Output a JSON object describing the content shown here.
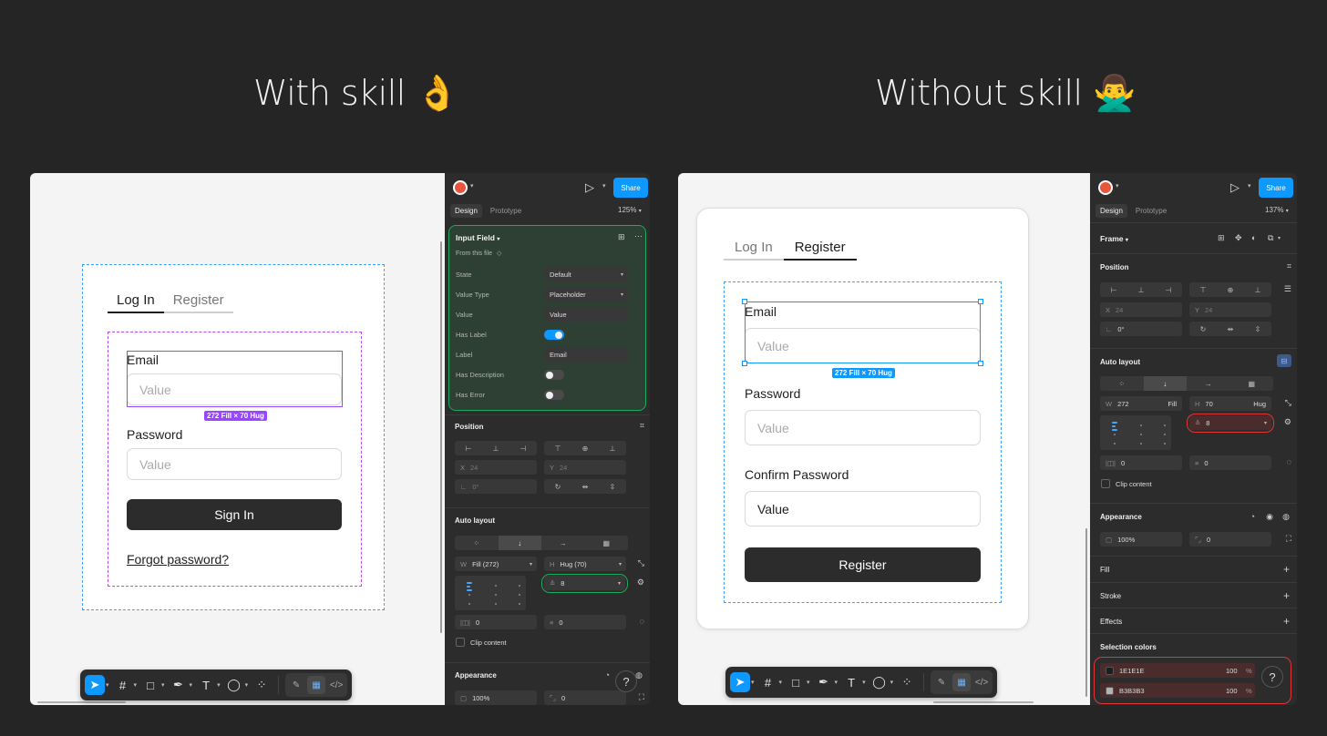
{
  "headings": {
    "left": "With skill 👌",
    "right": "Without skill 🙅‍♂️"
  },
  "left": {
    "canvas": {
      "tabs": [
        "Log In",
        "Register"
      ],
      "email_label": "Email",
      "email_placeholder": "Value",
      "size_tag": "272 Fill × 70 Hug",
      "password_label": "Password",
      "password_placeholder": "Value",
      "sign_in": "Sign In",
      "forgot": "Forgot password?"
    },
    "panel": {
      "share": "Share",
      "tabs": [
        "Design",
        "Prototype"
      ],
      "zoom": "125%",
      "component": {
        "name": "Input Field",
        "source": "From this file",
        "rows": [
          {
            "label": "State",
            "value": "Default",
            "kind": "select"
          },
          {
            "label": "Value Type",
            "value": "Placeholder",
            "kind": "select"
          },
          {
            "label": "Value",
            "value": "Value",
            "kind": "text"
          },
          {
            "label": "Has Label",
            "value": "on",
            "kind": "toggle"
          },
          {
            "label": "Label",
            "value": "Email",
            "kind": "text"
          },
          {
            "label": "Has Description",
            "value": "off",
            "kind": "toggle"
          },
          {
            "label": "Has Error",
            "value": "off",
            "kind": "toggle"
          }
        ]
      },
      "position": {
        "title": "Position",
        "x_label": "X",
        "x_value": "24",
        "y_label": "Y",
        "y_value": "24",
        "rotation": "0°"
      },
      "auto_layout": {
        "title": "Auto layout",
        "w_label": "W",
        "w_value": "Fill (272)",
        "h_label": "H",
        "h_value": "Hug (70)",
        "gap": "8",
        "pad_h": "0",
        "pad_v": "0",
        "clip": "Clip content"
      },
      "appearance": {
        "title": "Appearance",
        "opacity": "100%",
        "radius": "0"
      }
    }
  },
  "right": {
    "canvas": {
      "tabs": [
        "Log In",
        "Register"
      ],
      "email_label": "Email",
      "email_placeholder": "Value",
      "size_tag": "272 Fill × 70 Hug",
      "password_label": "Password",
      "password_placeholder": "Value",
      "confirm_label": "Confirm Password",
      "confirm_value": "Value",
      "register": "Register"
    },
    "panel": {
      "share": "Share",
      "tabs": [
        "Design",
        "Prototype"
      ],
      "zoom": "137%",
      "frame_title": "Frame",
      "position": {
        "title": "Position",
        "x_label": "X",
        "x_value": "24",
        "y_label": "Y",
        "y_value": "24",
        "rotation": "0°"
      },
      "auto_layout": {
        "title": "Auto layout",
        "w_label": "W",
        "w_value": "272",
        "w_mode": "Fill",
        "h_label": "H",
        "h_value": "70",
        "h_mode": "Hug",
        "gap": "8",
        "pad_h": "0",
        "pad_v": "0",
        "clip": "Clip content"
      },
      "appearance": {
        "title": "Appearance",
        "opacity": "100%",
        "radius": "0"
      },
      "fill": "Fill",
      "stroke": "Stroke",
      "effects": "Effects",
      "selection_colors": {
        "title": "Selection colors",
        "items": [
          {
            "hex": "1E1E1E",
            "swatch": "#1E1E1E",
            "opacity": "100",
            "unit": "%"
          },
          {
            "hex": "B3B3B3",
            "swatch": "#B3B3B3",
            "opacity": "100",
            "unit": "%"
          }
        ]
      }
    }
  },
  "colors": {
    "accent_blue": "#0d99ff",
    "good_green": "#14ae5c",
    "bad_red": "#e03636",
    "select_purple": "#9747ff"
  }
}
